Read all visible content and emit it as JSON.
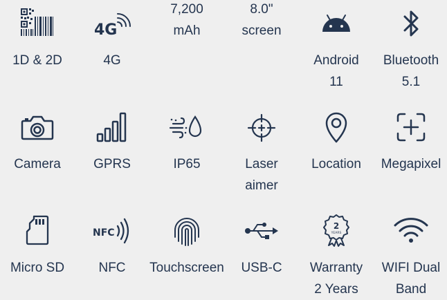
{
  "features": [
    {
      "label": "1D & 2D",
      "icon": "barcode-qrcode-icon"
    },
    {
      "label": "4G",
      "icon": "4g-signal-icon",
      "icon_text": "4G"
    },
    {
      "label": "7,200\nmAh",
      "icon": ""
    },
    {
      "label": "8.0\"\nscreen",
      "icon": ""
    },
    {
      "label": "Android\n11",
      "icon": "android-icon"
    },
    {
      "label": "Bluetooth\n5.1",
      "icon": "bluetooth-icon"
    },
    {
      "label": "Camera",
      "icon": "camera-icon"
    },
    {
      "label": "GPRS",
      "icon": "signal-bars-icon"
    },
    {
      "label": "IP65",
      "icon": "water-dust-icon"
    },
    {
      "label": "Laser\naimer",
      "icon": "crosshair-icon"
    },
    {
      "label": "Location",
      "icon": "location-pin-icon"
    },
    {
      "label": "Megapixel",
      "icon": "focus-frame-icon"
    },
    {
      "label": "Micro SD",
      "icon": "sd-card-icon"
    },
    {
      "label": "NFC",
      "icon": "nfc-icon",
      "icon_text": "NFC"
    },
    {
      "label": "Touchscreen",
      "icon": "fingerprint-icon"
    },
    {
      "label": "USB-C",
      "icon": "usb-icon"
    },
    {
      "label": "Warranty\n2 Years",
      "icon": "warranty-badge-icon",
      "icon_text": "2",
      "icon_subtext": "YEARS"
    },
    {
      "label": "WIFI Dual\nBand",
      "icon": "wifi-icon"
    }
  ]
}
